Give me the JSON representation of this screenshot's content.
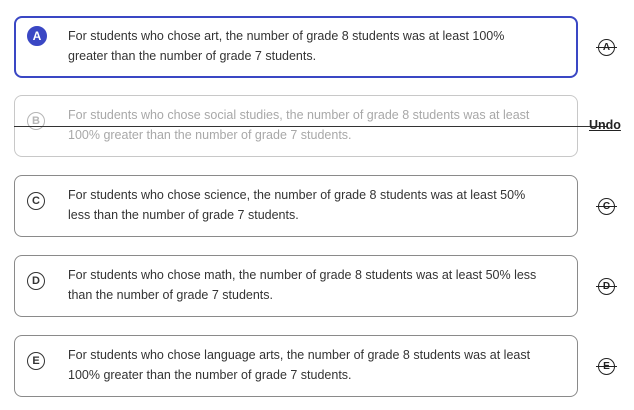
{
  "options": [
    {
      "letter": "A",
      "text": "For students who chose art, the number of grade 8 students was at least 100% greater than the number of grade 7 students."
    },
    {
      "letter": "B",
      "text": "For students who chose social studies, the number of grade 8 students was at least 100% greater than the number of grade 7 students."
    },
    {
      "letter": "C",
      "text": "For students who chose science, the number of grade 8 students was at least 50% less than the number of grade 7 students."
    },
    {
      "letter": "D",
      "text": "For students who chose math, the number of grade 8 students was at least 50% less than the number of grade 7 students."
    },
    {
      "letter": "E",
      "text": "For students who chose language arts, the number of grade 8 students was at least 100% greater than the number of grade 7 students."
    }
  ],
  "undo_label": "Undo",
  "colors": {
    "selected": "#3a47c4",
    "eliminated_text": "#a8a8a8"
  }
}
